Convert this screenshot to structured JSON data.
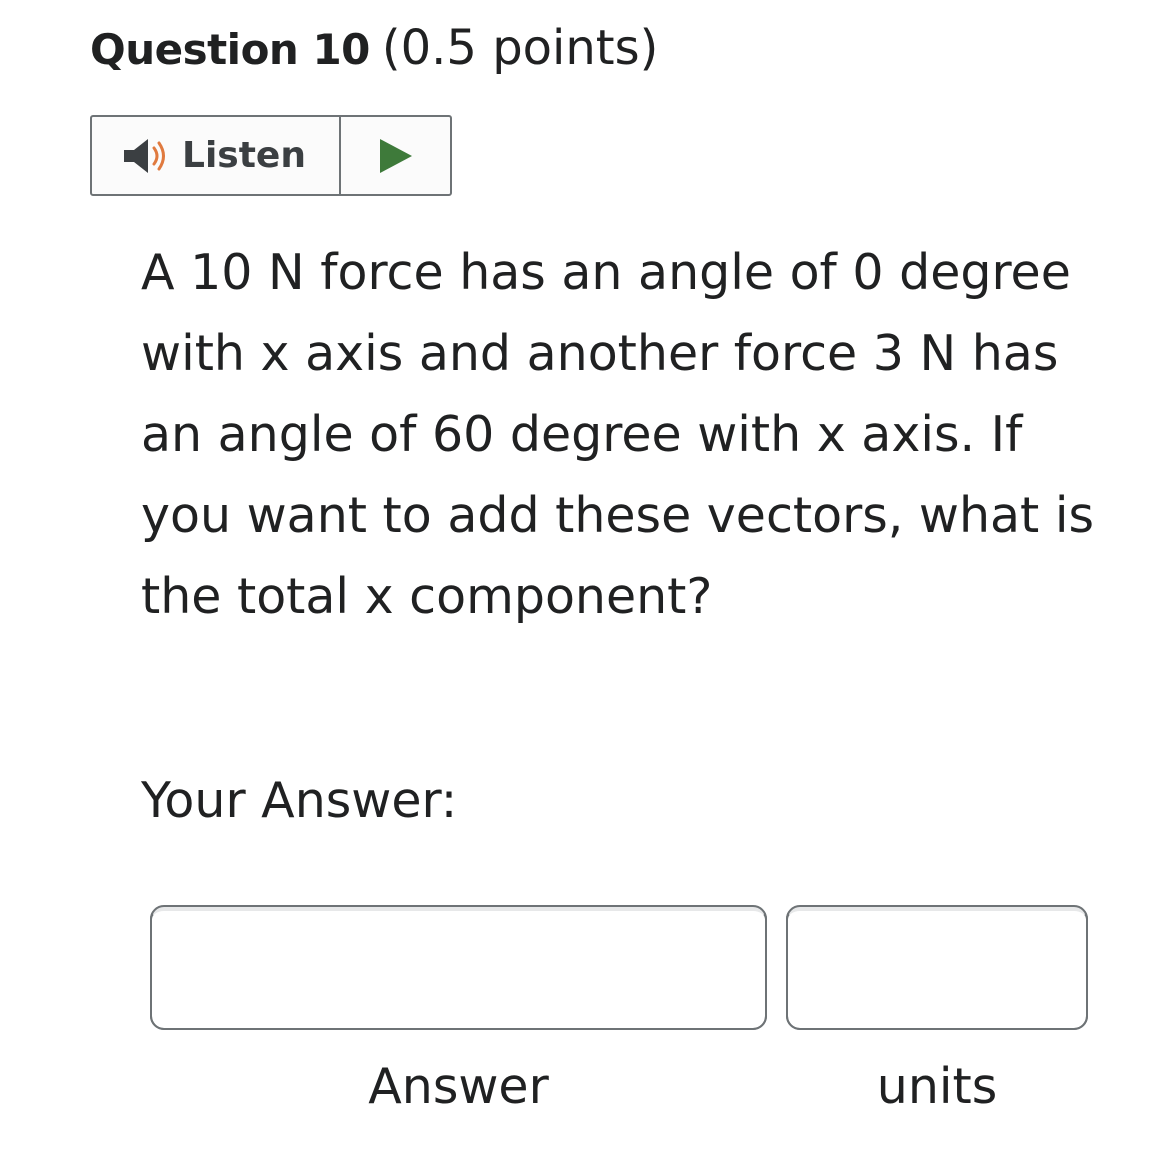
{
  "question": {
    "number_label": "Question 10",
    "points_label": "(0.5 points)",
    "text": "A 10 N force has an angle of 0 degree with x axis and another force 3 N has an angle of 60 degree with x axis. If you want to add these vectors, what is the total x component?"
  },
  "listen": {
    "label": "Listen",
    "speaker_icon": "speaker-icon",
    "play_icon": "play-icon",
    "play_color": "#3e7a3a",
    "speaker_color": "#3b3f42",
    "sound_wave_color": "#e07a3f"
  },
  "answer_section": {
    "prompt": "Your Answer:",
    "answer_value": "",
    "units_value": "",
    "answer_caption": "Answer",
    "units_caption": "units"
  }
}
